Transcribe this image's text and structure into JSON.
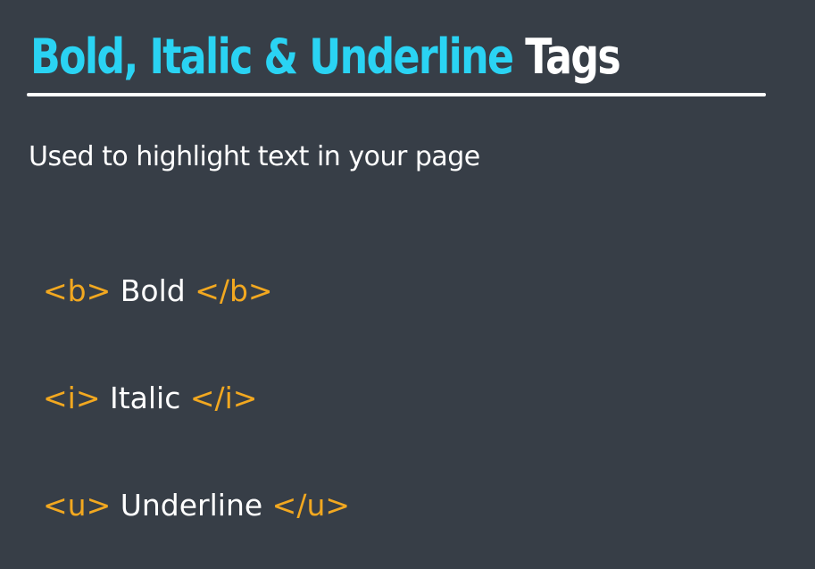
{
  "title": {
    "accent": "Bold, Italic & Underline",
    "rest": "Tags",
    "accent_color": "#2ad3f3"
  },
  "subtitle": "Used to highlight text in your page",
  "examples": [
    {
      "open_tag": "<b>",
      "text": "Bold",
      "close_tag": "</b>"
    },
    {
      "open_tag": "<i>",
      "text": "Italic",
      "close_tag": "</i>"
    },
    {
      "open_tag": "<u>",
      "text": "Underline",
      "close_tag": "</u>"
    }
  ],
  "colors": {
    "background": "#373e47",
    "tag": "#f2a820",
    "text": "#ffffff"
  }
}
